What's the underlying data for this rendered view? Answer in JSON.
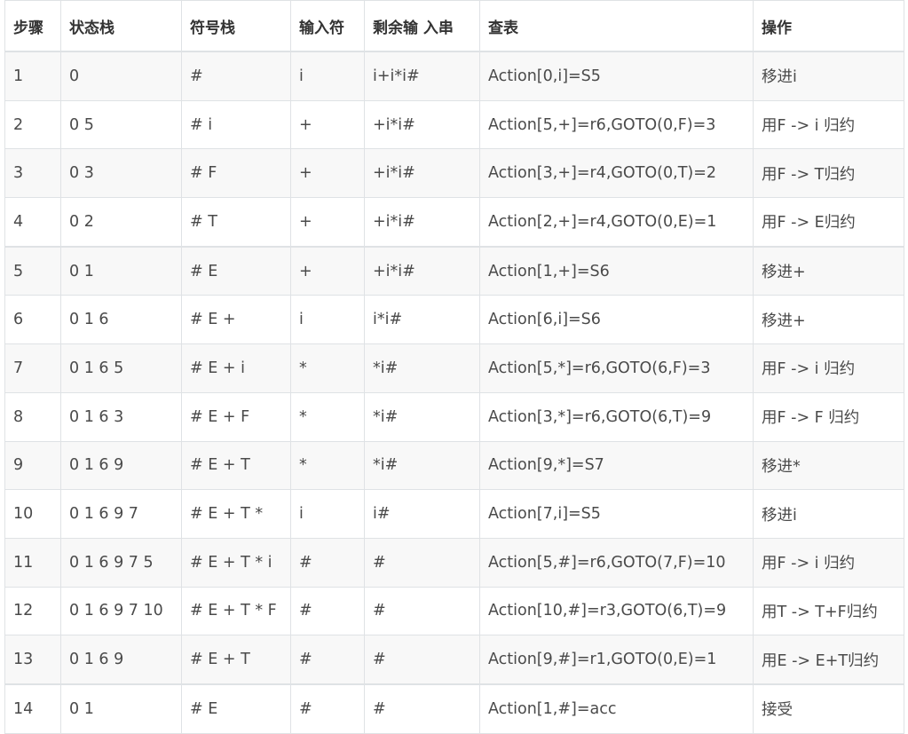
{
  "table": {
    "headers": [
      "步骤",
      "状态栈",
      "符号栈",
      "输入符",
      "剩余输 入串",
      "查表",
      "操作"
    ],
    "rows": [
      [
        "1",
        "0",
        "#",
        "i",
        "i+i*i#",
        "Action[0,i]=S5",
        "移进i"
      ],
      [
        "2",
        "0 5",
        "# i",
        "+",
        "+i*i#",
        "Action[5,+]=r6,GOTO(0,F)=3",
        "用F -> i 归约"
      ],
      [
        "3",
        "0 3",
        "# F",
        "+",
        "+i*i#",
        "Action[3,+]=r4,GOTO(0,T)=2",
        "用F -> T归约"
      ],
      [
        "4",
        "0 2",
        "# T",
        "+",
        "+i*i#",
        "Action[2,+]=r4,GOTO(0,E)=1",
        "用F -> E归约"
      ],
      [
        "5",
        "0 1",
        "# E",
        "+",
        "+i*i#",
        "Action[1,+]=S6",
        "移进+"
      ],
      [
        "6",
        "0 1 6",
        "# E +",
        "i",
        "i*i#",
        "Action[6,i]=S6",
        "移进+"
      ],
      [
        "7",
        "0 1 6 5",
        "# E + i",
        "*",
        "*i#",
        "Action[5,*]=r6,GOTO(6,F)=3",
        "用F -> i 归约"
      ],
      [
        "8",
        "0 1 6 3",
        "# E + F",
        "*",
        "*i#",
        "Action[3,*]=r6,GOTO(6,T)=9",
        "用F -> F 归约"
      ],
      [
        "9",
        "0 1 6 9",
        "# E + T",
        "*",
        "*i#",
        "Action[9,*]=S7",
        "移进*"
      ],
      [
        "10",
        "0 1 6 9 7",
        "# E + T *",
        "i",
        "i#",
        "Action[7,i]=S5",
        "移进i"
      ],
      [
        "11",
        "0 1 6 9 7 5",
        "# E + T * i",
        "#",
        "#",
        "Action[5,#]=r6,GOTO(7,F)=10",
        "用F -> i 归约"
      ],
      [
        "12",
        "0 1 6 9 7 10",
        "# E + T * F",
        "#",
        "#",
        "Action[10,#]=r3,GOTO(6,T)=9",
        "用T -> T+F归约"
      ],
      [
        "13",
        "0 1 6 9",
        "# E + T",
        "#",
        "#",
        "Action[9,#]=r1,GOTO(0,E)=1",
        "用E -> E+T归约"
      ],
      [
        "14",
        "0 1",
        "# E",
        "#",
        "#",
        "Action[1,#]=acc",
        "接受"
      ]
    ]
  }
}
